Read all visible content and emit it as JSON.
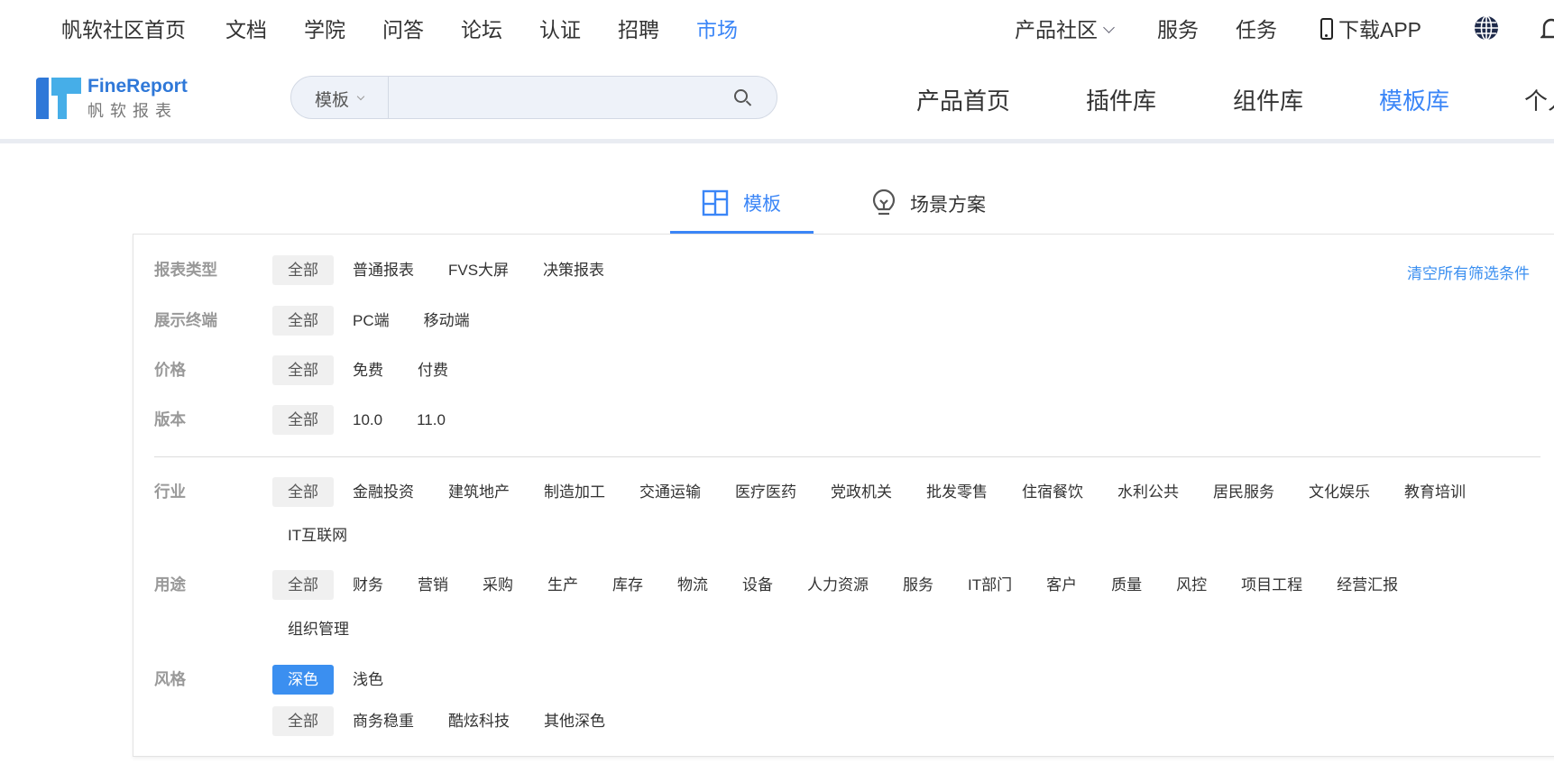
{
  "top_nav": {
    "left": [
      "帆软社区首页",
      "文档",
      "学院",
      "问答",
      "论坛",
      "认证",
      "招聘",
      "市场"
    ],
    "active": "市场",
    "right": {
      "community": "产品社区",
      "service": "服务",
      "task": "任务",
      "download": "下载APP"
    }
  },
  "logo": {
    "brand": "FineReport",
    "sub": "帆软报表"
  },
  "search": {
    "category": "模板",
    "placeholder": ""
  },
  "product_nav": [
    "产品首页",
    "插件库",
    "组件库",
    "模板库",
    "个人"
  ],
  "product_nav_active": "模板库",
  "tabs": [
    {
      "label": "模板",
      "icon": "layout-icon"
    },
    {
      "label": "场景方案",
      "icon": "lightbulb-icon"
    }
  ],
  "clear_filters": "清空所有筛选条件",
  "colors": {
    "accent": "#3b86f7",
    "chip_active": "#3b8ff0"
  },
  "filters": [
    {
      "label": "报表类型",
      "lines": [
        [
          "全部",
          "普通报表",
          "FVS大屏",
          "决策报表"
        ]
      ],
      "selected": "全部"
    },
    {
      "label": "展示终端",
      "lines": [
        [
          "全部",
          "PC端",
          "移动端"
        ]
      ],
      "selected": "全部"
    },
    {
      "label": "价格",
      "lines": [
        [
          "全部",
          "免费",
          "付费"
        ]
      ],
      "selected": "全部"
    },
    {
      "label": "版本",
      "lines": [
        [
          "全部",
          "10.0",
          "11.0"
        ]
      ],
      "selected": "全部"
    },
    {
      "label": "行业",
      "lines": [
        [
          "全部",
          "金融投资",
          "建筑地产",
          "制造加工",
          "交通运输",
          "医疗医药",
          "党政机关",
          "批发零售",
          "住宿餐饮",
          "水利公共",
          "居民服务",
          "文化娱乐",
          "教育培训"
        ],
        [
          "IT互联网"
        ]
      ],
      "selected": "全部"
    },
    {
      "label": "用途",
      "lines": [
        [
          "全部",
          "财务",
          "营销",
          "采购",
          "生产",
          "库存",
          "物流",
          "设备",
          "人力资源",
          "服务",
          "IT部门",
          "客户",
          "质量",
          "风控",
          "项目工程",
          "经营汇报"
        ],
        [
          "组织管理"
        ]
      ],
      "selected": "全部"
    },
    {
      "label": "风格",
      "lines": [
        [
          "深色",
          "浅色"
        ],
        [
          "全部",
          "商务稳重",
          "酷炫科技",
          "其他深色"
        ]
      ],
      "selected": "深色",
      "selected2": "全部"
    }
  ]
}
